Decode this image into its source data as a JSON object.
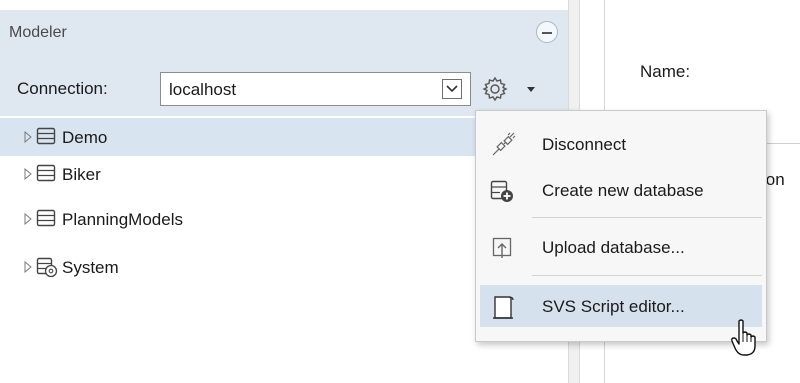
{
  "panel": {
    "title": "Modeler",
    "connection_label": "Connection:",
    "connection_value": "localhost"
  },
  "tree": {
    "items": [
      {
        "label": "Demo",
        "icon": "database-icon",
        "selected": true
      },
      {
        "label": "Biker",
        "icon": "database-icon",
        "selected": false
      },
      {
        "label": "PlanningModels",
        "icon": "database-icon",
        "selected": false
      },
      {
        "label": "System",
        "icon": "system-database-icon",
        "selected": false
      }
    ]
  },
  "right": {
    "name_label": "Name:",
    "clipped_label": "ion"
  },
  "menu": {
    "items": [
      {
        "label": "Disconnect",
        "icon": "disconnect-plug-icon"
      },
      {
        "label": "Create new database",
        "icon": "create-database-icon"
      },
      {
        "label": "Upload database...",
        "icon": "upload-icon"
      },
      {
        "label": "SVS Script editor...",
        "icon": "script-scroll-icon"
      }
    ]
  },
  "colors": {
    "panel_header_bg": "#dfe7f1",
    "selection_bg": "#d9e4f1",
    "menu_hover_bg": "#d6e1ee",
    "menu_bg": "#f7f7f7"
  }
}
